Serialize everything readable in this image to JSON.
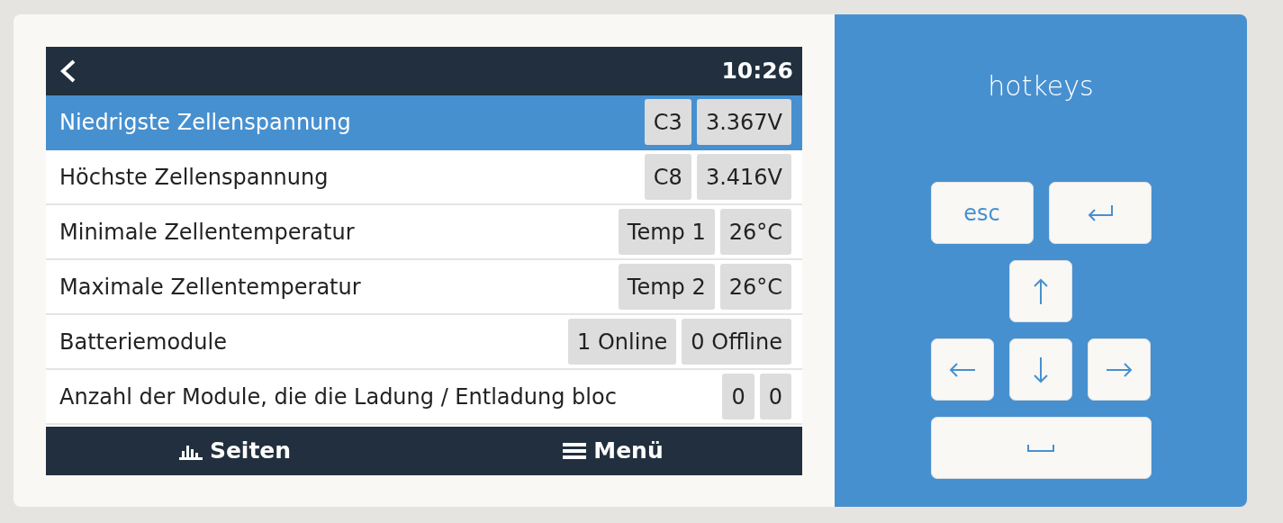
{
  "screen": {
    "time": "10:26",
    "rows": [
      {
        "label": "Niedrigste Zellenspannung",
        "selected": true,
        "values": [
          "C3",
          "3.367V"
        ]
      },
      {
        "label": "Höchste Zellenspannung",
        "selected": false,
        "values": [
          "C8",
          "3.416V"
        ]
      },
      {
        "label": "Minimale Zellentemperatur",
        "selected": false,
        "values": [
          "Temp 1",
          "26°C"
        ]
      },
      {
        "label": "Maximale Zellentemperatur",
        "selected": false,
        "values": [
          "Temp 2",
          "26°C"
        ]
      },
      {
        "label": "Batteriemodule",
        "selected": false,
        "values": [
          "1 Online",
          "0 Offline"
        ]
      },
      {
        "label": "Anzahl der Module, die die Ladung / Entladung bloc",
        "selected": false,
        "values": [
          "0",
          "0"
        ]
      }
    ],
    "footer": [
      {
        "kind": "pages",
        "label": "Seiten"
      },
      {
        "kind": "menu",
        "label": "Menü"
      }
    ]
  },
  "hotkeys": {
    "title": "hotkeys",
    "keys": [
      {
        "kind": "text",
        "label": "esc"
      },
      {
        "kind": "enter"
      },
      {
        "kind": "up"
      },
      {
        "kind": "left"
      },
      {
        "kind": "down"
      },
      {
        "kind": "right"
      },
      {
        "kind": "space"
      }
    ]
  }
}
